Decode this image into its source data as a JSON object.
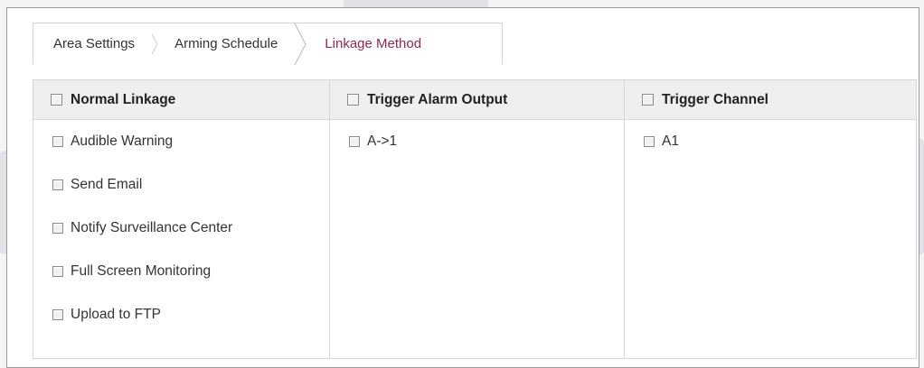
{
  "tabs": [
    {
      "label": "Area Settings",
      "active": false
    },
    {
      "label": "Arming Schedule",
      "active": false
    },
    {
      "label": "Linkage Method",
      "active": true
    }
  ],
  "colors": {
    "active_tab_text": "#8c2a52",
    "header_bg": "#efefef",
    "border": "#d6d6d6"
  },
  "columns": [
    {
      "header": "Normal Linkage",
      "items": [
        {
          "label": "Audible Warning",
          "checked": false
        },
        {
          "label": "Send Email",
          "checked": false
        },
        {
          "label": "Notify Surveillance Center",
          "checked": false
        },
        {
          "label": "Full Screen Monitoring",
          "checked": false
        },
        {
          "label": "Upload to FTP",
          "checked": false
        }
      ]
    },
    {
      "header": "Trigger Alarm Output",
      "items": [
        {
          "label": "A->1",
          "checked": false
        }
      ]
    },
    {
      "header": "Trigger Channel",
      "items": [
        {
          "label": "A1",
          "checked": false
        }
      ]
    }
  ]
}
